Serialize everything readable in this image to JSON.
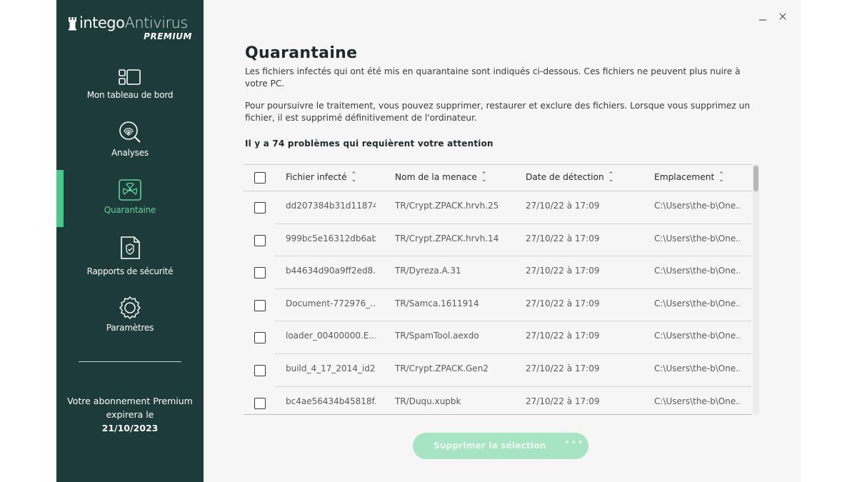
{
  "app": {
    "brand_main": "intego",
    "brand_sub": "Antivirus",
    "edition": "PREMIUM"
  },
  "window": {
    "minimize_icon": "minimize-icon",
    "close_icon": "close-icon"
  },
  "sidebar": {
    "items": [
      {
        "label": "Mon tableau de bord",
        "icon": "dashboard-icon"
      },
      {
        "label": "Analyses",
        "icon": "fingerprint-search-icon"
      },
      {
        "label": "Quarantaine",
        "icon": "quarantine-icon",
        "active": true
      },
      {
        "label": "Rapports de sécurité",
        "icon": "report-icon"
      },
      {
        "label": "Paramètres",
        "icon": "gear-icon"
      }
    ],
    "subscription": {
      "text_line1": "Votre abonnement Premium",
      "text_line2": "expirera le",
      "date": "21/10/2023"
    }
  },
  "main": {
    "title": "Quarantaine",
    "para1": "Les fichiers infectés qui ont été mis en quarantaine sont indiqués ci-dessous. Ces fichiers ne peuvent plus nuire à votre PC.",
    "para2": "Pour poursuivre le traitement, vous pouvez supprimer, restaurer et exclure des fichiers. Lorsque vous supprimez un fichier, il est supprimé définitivement de l'ordinateur.",
    "count": "Il y a 74 problèmes qui requièrent votre attention",
    "table": {
      "headers": [
        "Fichier infecté",
        "Nom de la menace",
        "Date de détection",
        "Emplacement"
      ],
      "rows": [
        [
          "dd207384b31d11874...",
          "TR/Crypt.ZPACK.hrvh.25",
          "27/10/22 à 17:09",
          "C:\\Users\\the-b\\One..."
        ],
        [
          "999bc5e16312db6ab...",
          "TR/Crypt.ZPACK.hrvh.14",
          "27/10/22 à 17:09",
          "C:\\Users\\the-b\\One..."
        ],
        [
          "b44634d90a9ff2ed8...",
          "TR/Dyreza.A.31",
          "27/10/22 à 17:09",
          "C:\\Users\\the-b\\One..."
        ],
        [
          "Document-772976_...",
          "TR/Samca.1611914",
          "27/10/22 à 17:09",
          "C:\\Users\\the-b\\One..."
        ],
        [
          "loader_00400000.E...",
          "TR/SpamTool.aexdo",
          "27/10/22 à 17:09",
          "C:\\Users\\the-b\\One..."
        ],
        [
          "build_4_17_2014_id2...",
          "TR/Crypt.ZPACK.Gen2",
          "27/10/22 à 17:09",
          "C:\\Users\\the-b\\One..."
        ],
        [
          "bc4ae56434b45818f...",
          "TR/Duqu.xupbk",
          "27/10/22 à 17:09",
          "C:\\Users\\the-b\\One..."
        ]
      ]
    },
    "delete_button": "Supprimer la sélection",
    "more_button": "•••"
  },
  "colors": {
    "sidebar_bg": "#1d3b3a",
    "accent": "#48c989",
    "button_disabled": "#a6e4c4"
  }
}
